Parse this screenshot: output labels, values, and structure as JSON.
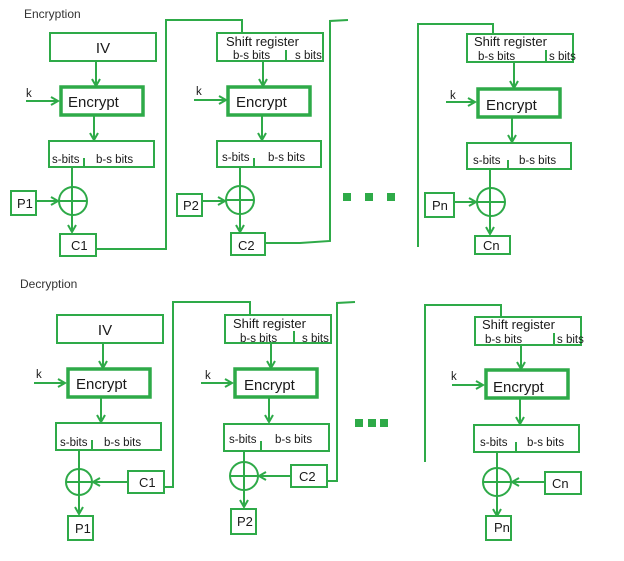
{
  "encryption": {
    "title": "Encryption",
    "stage1": {
      "iv": "IV",
      "key": "k",
      "encrypt": "Encrypt",
      "s_bits": "s-bits",
      "bs_bits": "b-s bits",
      "plain": "P1",
      "cipher": "C1"
    },
    "stage2": {
      "shift_register": "Shift register",
      "sr_bs_bits": "b-s bits",
      "sr_s_bits": "s bits",
      "key": "k",
      "encrypt": "Encrypt",
      "s_bits": "s-bits",
      "bs_bits": "b-s bits",
      "plain": "P2",
      "cipher": "C2"
    },
    "stageN": {
      "shift_register": "Shift register",
      "sr_bs_bits": "b-s bits",
      "sr_s_bits": "s bits",
      "key": "k",
      "encrypt": "Encrypt",
      "s_bits": "s-bits",
      "bs_bits": "b-s bits",
      "plain": "Pn",
      "cipher": "Cn"
    }
  },
  "decryption": {
    "title": "Decryption",
    "stage1": {
      "iv": "IV",
      "key": "k",
      "encrypt": "Encrypt",
      "s_bits": "s-bits",
      "bs_bits": "b-s bits",
      "cipher": "C1",
      "plain": "P1"
    },
    "stage2": {
      "shift_register": "Shift register",
      "sr_bs_bits": "b-s bits",
      "sr_s_bits": "s bits",
      "key": "k",
      "encrypt": "Encrypt",
      "s_bits": "s-bits",
      "bs_bits": "b-s bits",
      "cipher": "C2",
      "plain": "P2"
    },
    "stageN": {
      "shift_register": "Shift register",
      "sr_bs_bits": "b-s bits",
      "sr_s_bits": "s bits",
      "key": "k",
      "encrypt": "Encrypt",
      "s_bits": "s-bits",
      "bs_bits": "b-s bits",
      "cipher": "Cn",
      "plain": "Pn"
    }
  },
  "colors": {
    "line": "#2eaa48"
  }
}
